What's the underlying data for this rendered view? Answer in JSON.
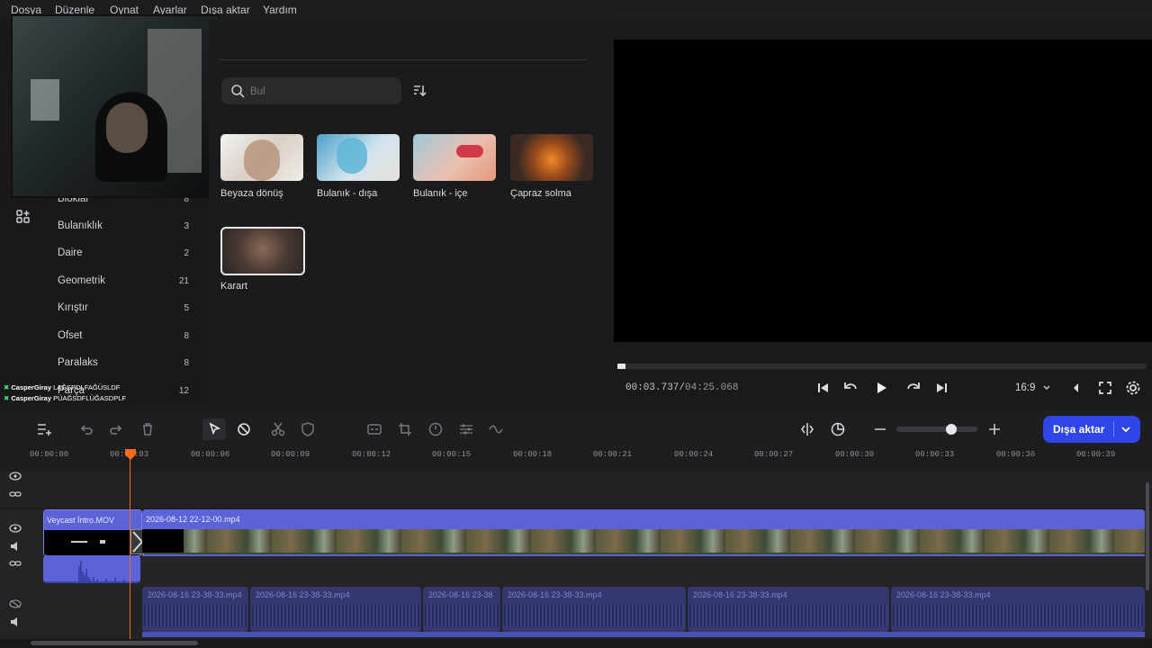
{
  "menu": {
    "items": [
      "Dosya",
      "Düzenle",
      "Oynat",
      "Ayarlar",
      "Dışa aktar",
      "Yardım"
    ]
  },
  "search": {
    "placeholder": "Bul"
  },
  "categories": [
    {
      "label": "Bloklar",
      "count": "8"
    },
    {
      "label": "Bulanıklık",
      "count": "3"
    },
    {
      "label": "Daire",
      "count": "2"
    },
    {
      "label": "Geometrik",
      "count": "21"
    },
    {
      "label": "Kırıştır",
      "count": "5"
    },
    {
      "label": "Ofset",
      "count": "8"
    },
    {
      "label": "Paralaks",
      "count": "8"
    },
    {
      "label": "Parça",
      "count": "12"
    }
  ],
  "transitions": [
    {
      "label": "Beyaza dönüş"
    },
    {
      "label": "Bulanık - dışa"
    },
    {
      "label": "Bulanık - içe"
    },
    {
      "label": "Çapraz solma"
    },
    {
      "label": "Karart"
    }
  ],
  "chat": [
    {
      "user": "CasperGiray",
      "message": "LAĞSPDLFAĞÜSLDF"
    },
    {
      "user": "CasperGiray",
      "message": "PÜAĞSDFLÜĞASDPLF"
    }
  ],
  "player": {
    "current": "00:03.737",
    "total": "04:25.068",
    "aspect": "16:9"
  },
  "export": {
    "label": "Dışa aktar"
  },
  "ruler": {
    "ticks": [
      "00:00:00",
      "00:00:03",
      "00:00:06",
      "00:00:09",
      "00:00:12",
      "00:00:15",
      "00:00:18",
      "00:00:21",
      "00:00:24",
      "00:00:27",
      "00:00:30",
      "00:00:33",
      "00:00:36",
      "00:00:39"
    ]
  },
  "clips": {
    "intro": "Veycast İntro.MOV",
    "main": "2026-08-12 22-12-00.mp4",
    "audio": [
      "2026-08-16 23-38-33.mp4",
      "2026-08-16 23-38-33.mp4",
      "2026-08-16 23-38",
      "2026-08-16 23-38-33.mp4",
      "2026-08-16 23-38-33.mp4",
      "2026-08-16 23-38-33.mp4"
    ]
  },
  "colors": {
    "accent": "#2f45e8",
    "clip": "#5b63d6",
    "playhead": "#ff6a1a"
  }
}
